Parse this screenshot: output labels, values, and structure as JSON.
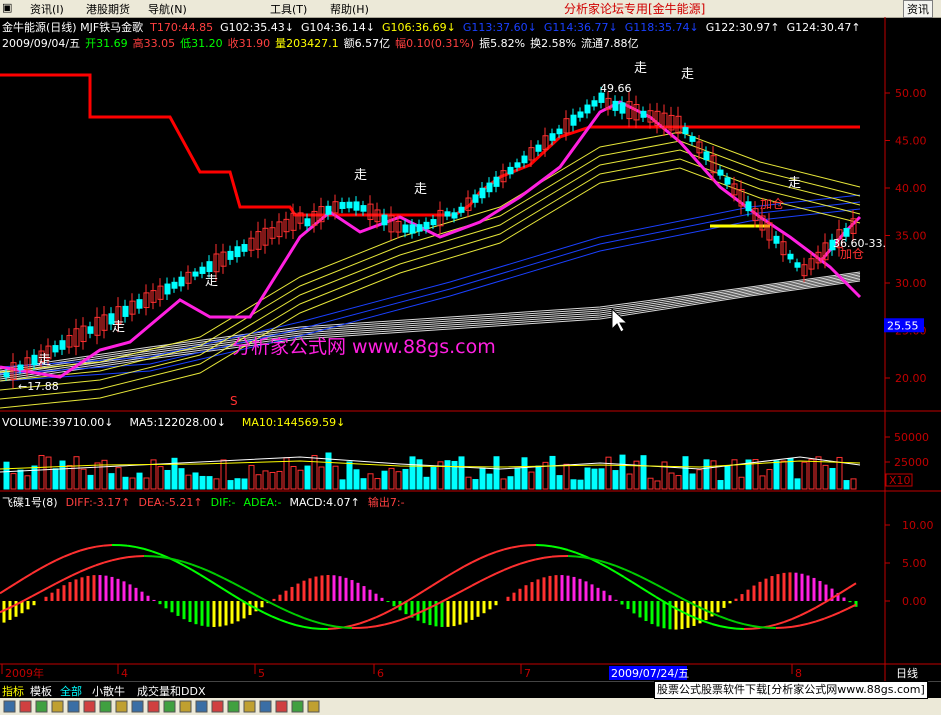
{
  "menubar": {
    "items": [
      "资讯(I)",
      "港股期货",
      "导航(N)",
      "工具(T)",
      "帮助(H)"
    ],
    "forum_title": "分析家论坛专用[金牛能源]",
    "right_button": "资讯"
  },
  "header": {
    "line1": [
      {
        "text": "金牛能源(日线) MJF铁马金歌",
        "color": "#ffffff"
      },
      {
        "text": "T170:44.85",
        "color": "#ff4040"
      },
      {
        "text": "G102:35.43↓",
        "color": "#ffffff"
      },
      {
        "text": "G104:36.14↓",
        "color": "#ffffff"
      },
      {
        "text": "G106:36.69↓",
        "color": "#ffff00"
      },
      {
        "text": "G113:37.60↓",
        "color": "#1a40ff"
      },
      {
        "text": "G114:36.77↓",
        "color": "#1a40ff"
      },
      {
        "text": "G118:35.74↓",
        "color": "#1a40ff"
      },
      {
        "text": "G122:30.97↑",
        "color": "#ffffff"
      },
      {
        "text": "G124:30.47↑",
        "color": "#ffffff"
      }
    ],
    "line2": [
      {
        "text": "2009/09/04/五",
        "color": "#ffffff"
      },
      {
        "text": "开31.69",
        "color": "#00ff00"
      },
      {
        "text": "高33.05",
        "color": "#ff4040"
      },
      {
        "text": "低31.20",
        "color": "#00ff00"
      },
      {
        "text": "收31.90",
        "color": "#ff4040"
      },
      {
        "text": "量203427.1",
        "color": "#ffff00"
      },
      {
        "text": "额6.57亿",
        "color": "#ffffff"
      },
      {
        "text": "幅0.10(0.31%)",
        "color": "#ff4040"
      },
      {
        "text": "振5.82%",
        "color": "#ffffff"
      },
      {
        "text": "换2.58%",
        "color": "#ffffff"
      },
      {
        "text": "流通7.88亿",
        "color": "#ffffff"
      }
    ]
  },
  "price_panel": {
    "y_ticks": [
      "50.00",
      "45.00",
      "40.00",
      "35.00",
      "30.00",
      "25.00",
      "20.00"
    ],
    "current_price_tag": "25.55",
    "markers": [
      {
        "text": "走",
        "kind": "walk"
      },
      {
        "text": "走",
        "kind": "walk"
      },
      {
        "text": "走",
        "kind": "walk"
      },
      {
        "text": "走",
        "kind": "walk"
      },
      {
        "text": "走",
        "kind": "walk"
      },
      {
        "text": "走",
        "kind": "walk"
      },
      {
        "text": "走",
        "kind": "walk"
      },
      {
        "text": "走",
        "kind": "walk"
      }
    ],
    "high_label": "49.66",
    "low_label": "←17.88",
    "range_label": "36.60-33.",
    "buy_labels": [
      "加仓",
      "加仓"
    ],
    "watermark": "分析家公式网  www.88gs.com",
    "s_marker": "S"
  },
  "volume_panel": {
    "header": [
      {
        "text": "VOLUME:39710.00↓",
        "color": "#ffffff"
      },
      {
        "text": "MA5:122028.00↓",
        "color": "#ffffff"
      },
      {
        "text": "MA10:144569.59↓",
        "color": "#ffff00"
      }
    ],
    "y_ticks": [
      "50000",
      "25000"
    ],
    "unit": "X10"
  },
  "macd_panel": {
    "header": [
      {
        "text": "飞碟1号(8)",
        "color": "#ffffff"
      },
      {
        "text": "DIFF:-3.17↑",
        "color": "#ff4040"
      },
      {
        "text": "DEA:-5.21↑",
        "color": "#ff4040"
      },
      {
        "text": "DIF:-",
        "color": "#00ff00"
      },
      {
        "text": "ADEA:-",
        "color": "#00ff00"
      },
      {
        "text": "MACD:4.07↑",
        "color": "#ffffff"
      },
      {
        "text": "输出7:-",
        "color": "#ff4040"
      }
    ],
    "y_ticks": [
      "10.00",
      "5.00",
      "0.00"
    ]
  },
  "time_axis": {
    "labels": [
      "2009年",
      "4",
      "5",
      "6",
      "7",
      "8"
    ],
    "highlight_date": "2009/07/24/五",
    "period": "日线"
  },
  "bottom_tabs": [
    "指标",
    "模板",
    "全部",
    "小散牛",
    "成交量和DDX"
  ],
  "statusbar": {
    "ad_text": "股票公式股票软件下载[分析家公式网www.88gs.com]"
  },
  "colors": {
    "bull": "#ff3030",
    "bear": "#00ffff",
    "magenta_line": "#ff20e0",
    "stop_line": "#ff0000",
    "axis": "#c00000"
  }
}
